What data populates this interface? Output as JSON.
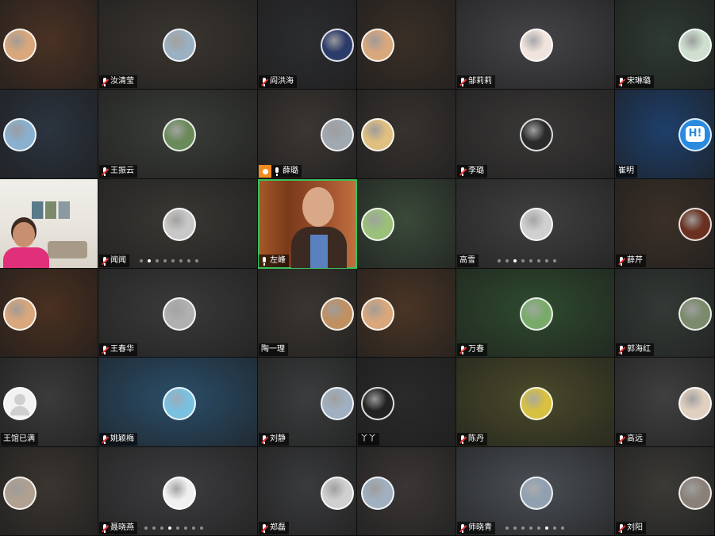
{
  "participants": [
    {
      "name": "",
      "mic": "none"
    },
    {
      "name": "汝清莹",
      "mic": "muted"
    },
    {
      "name": "阎洪海",
      "mic": "muted"
    },
    {
      "name": "",
      "mic": "none"
    },
    {
      "name": "邹莉莉",
      "mic": "muted"
    },
    {
      "name": "宋琳璐",
      "mic": "muted"
    },
    {
      "name": "",
      "mic": "none"
    },
    {
      "name": "王振云",
      "mic": "muted"
    },
    {
      "name": "薛璐",
      "mic": "on"
    },
    {
      "name": "",
      "mic": "none"
    },
    {
      "name": "李璐",
      "mic": "muted"
    },
    {
      "name": "崔明",
      "mic": "none"
    },
    {
      "name": "",
      "mic": "none"
    },
    {
      "name": "闻闻",
      "mic": "muted"
    },
    {
      "name": "左峰",
      "mic": "on"
    },
    {
      "name": "",
      "mic": "none"
    },
    {
      "name": "高雪",
      "mic": "none"
    },
    {
      "name": "薛芹",
      "mic": "muted"
    },
    {
      "name": "",
      "mic": "none"
    },
    {
      "name": "王春华",
      "mic": "muted"
    },
    {
      "name": "陶一理",
      "mic": "none"
    },
    {
      "name": "",
      "mic": "none"
    },
    {
      "name": "万春",
      "mic": "muted"
    },
    {
      "name": "郭海红",
      "mic": "muted"
    },
    {
      "name": "王馆已满",
      "mic": "none"
    },
    {
      "name": "姚颖梅",
      "mic": "muted"
    },
    {
      "name": "刘静",
      "mic": "muted"
    },
    {
      "name": "丫丫",
      "mic": "none"
    },
    {
      "name": "陈丹",
      "mic": "muted"
    },
    {
      "name": "高远",
      "mic": "muted"
    },
    {
      "name": "",
      "mic": "none"
    },
    {
      "name": "聂晓燕",
      "mic": "muted"
    },
    {
      "name": "郑磊",
      "mic": "muted"
    },
    {
      "name": "",
      "mic": "none"
    },
    {
      "name": "师晓青",
      "mic": "muted"
    },
    {
      "name": "刘阳",
      "mic": "muted"
    }
  ],
  "pagination": {
    "row3_col2": {
      "count": 8,
      "active": 1
    },
    "row3_col5": {
      "count": 8,
      "active": 2
    },
    "row6_col2": {
      "count": 8,
      "active": 3
    },
    "row6_col5": {
      "count": 8,
      "active": 5
    }
  },
  "colors": {
    "active_speaker": "#3ac25c",
    "host_badge": "#f58b1f",
    "muted_mic": "#e33333"
  }
}
